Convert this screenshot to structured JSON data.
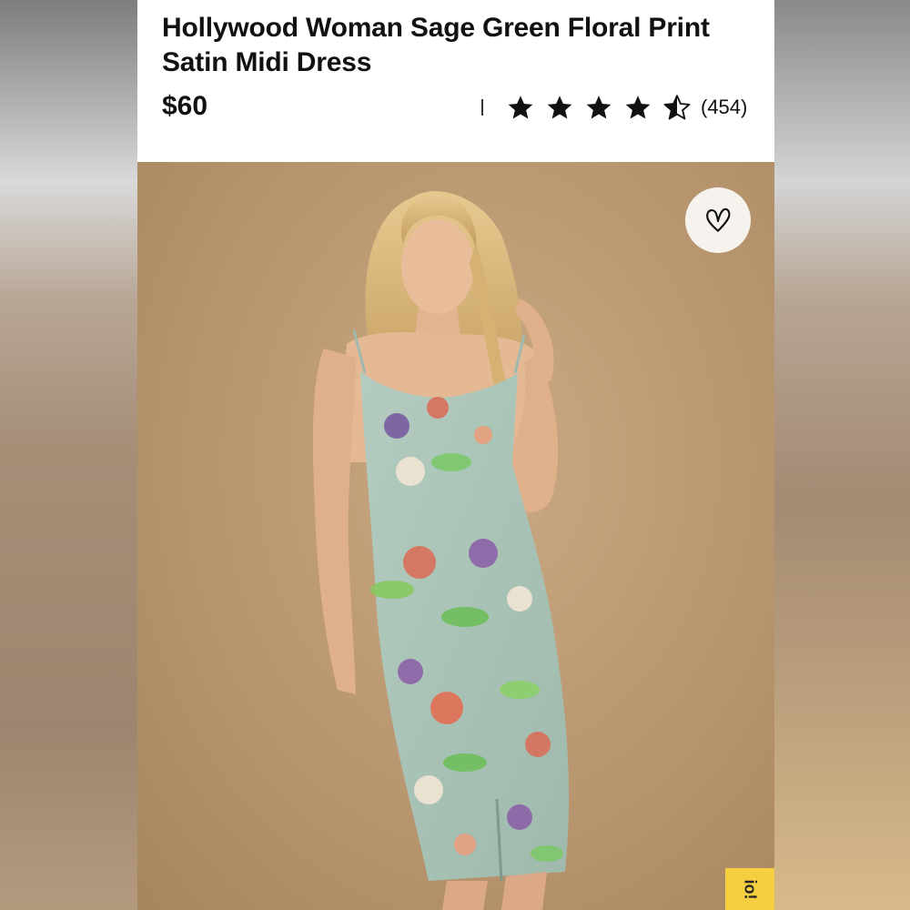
{
  "product": {
    "title": "Hollywood Woman Sage Green Floral Print Satin Midi Dress",
    "price": "$60",
    "rating": 4.5,
    "rating_max": 5,
    "review_count": "(454)"
  },
  "image": {
    "background_color": "#b8966f",
    "dress_color": "#a9c4b6"
  },
  "floating_tab": {
    "label": "io!"
  },
  "icons": {
    "favorite": "heart-icon",
    "star_full": "star-icon",
    "star_half": "half-star-icon"
  },
  "colors": {
    "text": "#111111",
    "badge": "#f5cf3f"
  }
}
